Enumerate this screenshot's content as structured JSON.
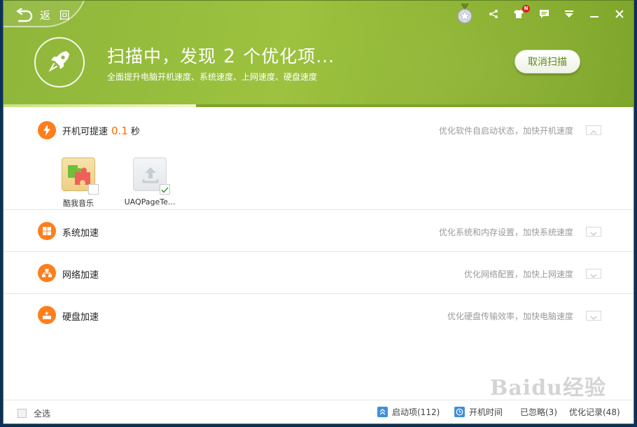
{
  "header": {
    "back_label": "返 回",
    "title_prefix": "扫描中，发现",
    "found_count": "2",
    "title_suffix": "个优化项...",
    "subtitle": "全面提升电脑开机速度、系统速度、上网速度、硬盘速度",
    "cancel_label": "取消扫描",
    "progress_fraction": 0.305,
    "badge_label": "N"
  },
  "sections": {
    "boot": {
      "title": "开机可提速",
      "speed": "0.1",
      "unit": "秒",
      "desc": "优化软件自启动状态，加快开机速度",
      "apps": [
        {
          "name": "酷我音乐",
          "checked": false
        },
        {
          "name": "UAQPageTe...",
          "checked": true
        }
      ]
    },
    "system": {
      "title": "系统加速",
      "desc": "优化系统和内存设置，加快系统速度"
    },
    "network": {
      "title": "网络加速",
      "desc": "优化网络配置，加快上网速度"
    },
    "disk": {
      "title": "硬盘加速",
      "desc": "优化硬盘传输效率，加快电脑速度"
    }
  },
  "footer": {
    "select_all": "全选",
    "startup": "启动项(112)",
    "boot_time": "开机时间",
    "ignored": "已忽略(3)",
    "history": "优化记录(48)"
  },
  "watermark": "Baidu经验",
  "colors": {
    "accent": "#ff7e1c",
    "header": "#8fb63a",
    "cancel_text": "#5a8a12"
  }
}
